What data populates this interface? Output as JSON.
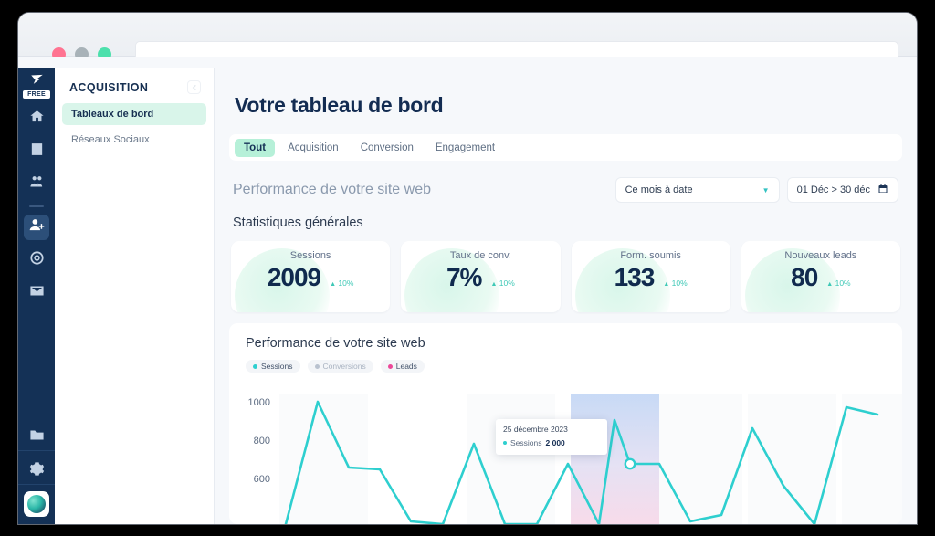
{
  "browser": {
    "close_label": "close",
    "minimize_label": "minimize",
    "maximize_label": "maximize",
    "address_value": "",
    "address_placeholder": ""
  },
  "rail": {
    "logo_glyph": "➤",
    "plan_badge": "FREE",
    "items": [
      {
        "name": "home-icon",
        "label": "Accueil"
      },
      {
        "name": "book-icon",
        "label": "Guides"
      },
      {
        "name": "users-icon",
        "label": "Contacts"
      },
      {
        "name": "user-add-icon",
        "label": "Acquisition"
      },
      {
        "name": "target-icon",
        "label": "Campagnes"
      },
      {
        "name": "mail-icon",
        "label": "Emails"
      },
      {
        "name": "folder-icon",
        "label": "Fichiers"
      },
      {
        "name": "gear-icon",
        "label": "Paramètres"
      }
    ]
  },
  "sidebar": {
    "title": "ACQUISITION",
    "items": [
      {
        "label": "Tableaux de bord",
        "active": true
      },
      {
        "label": "Réseaux Sociaux",
        "active": false
      }
    ]
  },
  "page": {
    "title": "Votre tableau de bord"
  },
  "tabs": [
    {
      "label": "Tout",
      "active": true
    },
    {
      "label": "Acquisition",
      "active": false
    },
    {
      "label": "Conversion",
      "active": false
    },
    {
      "label": "Engagement",
      "active": false
    }
  ],
  "section": {
    "title": "Performance de votre site web",
    "subtitle": "Statistiques générales",
    "period_value": "Ce mois à date",
    "date_range_value": "01 Déc > 30 déc"
  },
  "kpis": [
    {
      "label": "Sessions",
      "value": "2009",
      "delta": "10%",
      "trend": "up"
    },
    {
      "label": "Taux de conv.",
      "value": "7%",
      "delta": "10%",
      "trend": "up"
    },
    {
      "label": "Form. soumis",
      "value": "133",
      "delta": "10%",
      "trend": "up"
    },
    {
      "label": "Nouveaux leads",
      "value": "80",
      "delta": "10%",
      "trend": "up"
    }
  ],
  "chart_panel": {
    "title": "Performance de votre site web",
    "legend": [
      {
        "label": "Sessions",
        "color": "#2ecfcf",
        "active": true
      },
      {
        "label": "Conversions",
        "color": "#b9c2cf",
        "active": false
      },
      {
        "label": "Leads",
        "color": "#ec4899",
        "active": true
      }
    ],
    "tooltip": {
      "date": "25 décembre 2023",
      "series_label": "Sessions",
      "series_value": "2 000"
    }
  },
  "chart_data": {
    "type": "line",
    "title": "Performance de votre site web",
    "xlabel": "",
    "ylabel": "",
    "ylim": [
      400,
      1060
    ],
    "yticks": [
      600,
      800,
      1000
    ],
    "ytick_labels": [
      "600",
      "800",
      "1000"
    ],
    "grid": false,
    "legend_position": "top-left",
    "annotations": [
      {
        "type": "highlight-band",
        "from_index": 11,
        "to_index": 14,
        "label": "25 décembre 2023"
      },
      {
        "type": "hover-point",
        "index": 13,
        "series": "Sessions",
        "value": 660
      }
    ],
    "series": [
      {
        "name": "Sessions",
        "color": "#2ecfcf",
        "values": [
          440,
          960,
          640,
          630,
          450,
          440,
          700,
          430,
          430,
          610,
          420,
          850,
          660,
          660,
          440,
          460,
          760,
          490,
          440,
          910,
          880
        ]
      },
      {
        "name": "Conversions",
        "color": "#b9c2cf",
        "values": [],
        "hidden": true
      },
      {
        "name": "Leads",
        "color": "#ec4899",
        "values": [],
        "hidden": true
      }
    ]
  }
}
